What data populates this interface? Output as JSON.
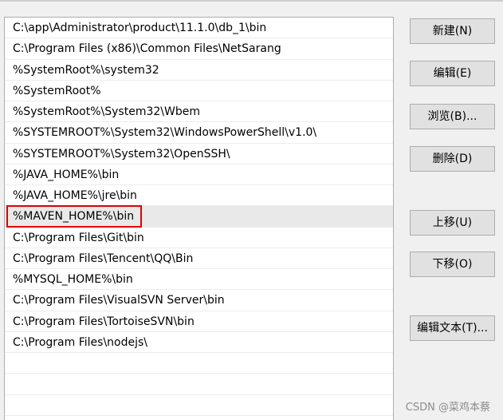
{
  "path_list": {
    "items": [
      "C:\\app\\Administrator\\product\\11.1.0\\db_1\\bin",
      "C:\\Program Files (x86)\\Common Files\\NetSarang",
      "%SystemRoot%\\system32",
      "%SystemRoot%",
      "%SystemRoot%\\System32\\Wbem",
      "%SYSTEMROOT%\\System32\\WindowsPowerShell\\v1.0\\",
      "%SYSTEMROOT%\\System32\\OpenSSH\\",
      "%JAVA_HOME%\\bin",
      "%JAVA_HOME%\\jre\\bin",
      "%MAVEN_HOME%\\bin",
      "C:\\Program Files\\Git\\bin",
      "C:\\Program Files\\Tencent\\QQ\\Bin",
      "%MYSQL_HOME%\\bin",
      "C:\\Program Files\\VisualSVN Server\\bin",
      "C:\\Program Files\\TortoiseSVN\\bin",
      "C:\\Program Files\\nodejs\\",
      "",
      "",
      ""
    ],
    "selected_index": 9,
    "highlight_color": "#e00000"
  },
  "buttons": {
    "new": "新建(N)",
    "edit": "编辑(E)",
    "browse": "浏览(B)...",
    "delete": "删除(D)",
    "move_up": "上移(U)",
    "move_down": "下移(O)",
    "edit_text": "编辑文本(T)..."
  },
  "watermark": "CSDN @菜鸡本蔡"
}
